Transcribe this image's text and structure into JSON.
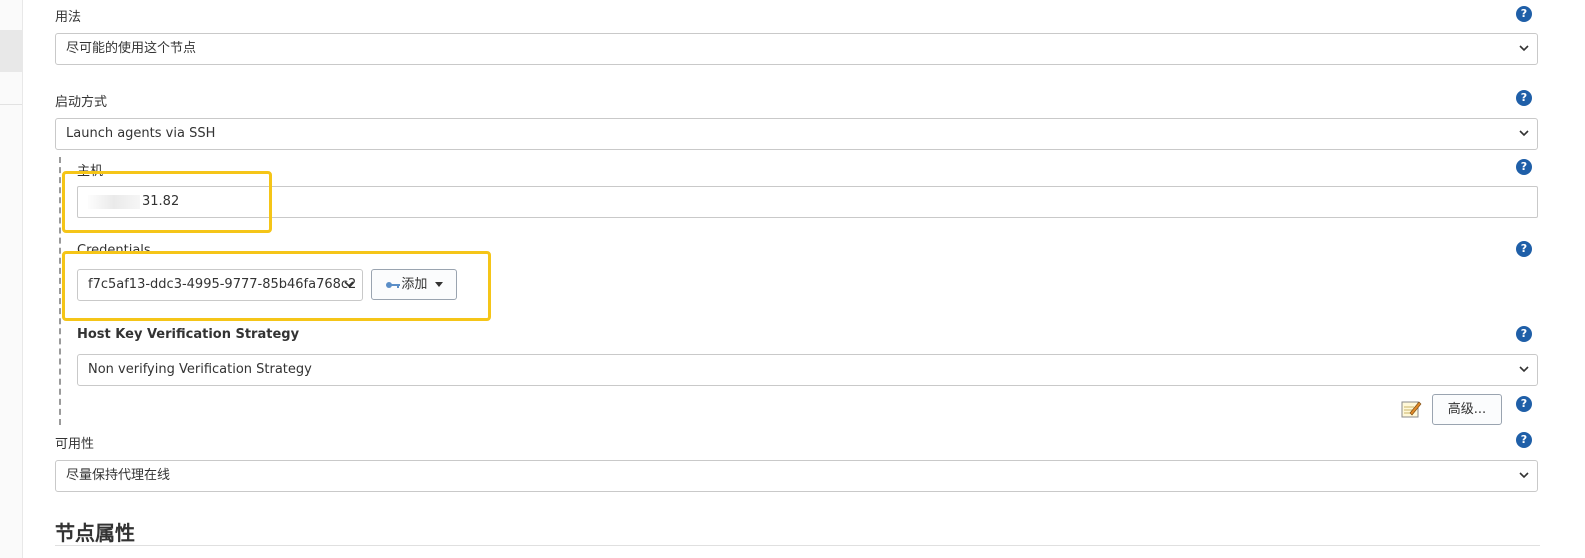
{
  "usage": {
    "label": "用法",
    "selected": "尽可能的使用这个节点"
  },
  "launch_method": {
    "label": "启动方式",
    "selected": "Launch agents via SSH"
  },
  "host": {
    "label": "主机",
    "value": "31.82"
  },
  "credentials": {
    "label": "Credentials",
    "selected": "f7c5af13-ddc3-4995-9777-85b46fa768c2",
    "add_button": "添加"
  },
  "host_key_strategy": {
    "label": "Host Key Verification Strategy",
    "selected": "Non verifying Verification Strategy"
  },
  "advanced_button": "高级...",
  "availability": {
    "label": "可用性",
    "selected": "尽量保持代理在线"
  },
  "node_properties": {
    "title": "节点属性"
  },
  "help_glyph": "?",
  "colors": {
    "help_icon": "#1f5fa8",
    "highlight": "#f5c518"
  }
}
